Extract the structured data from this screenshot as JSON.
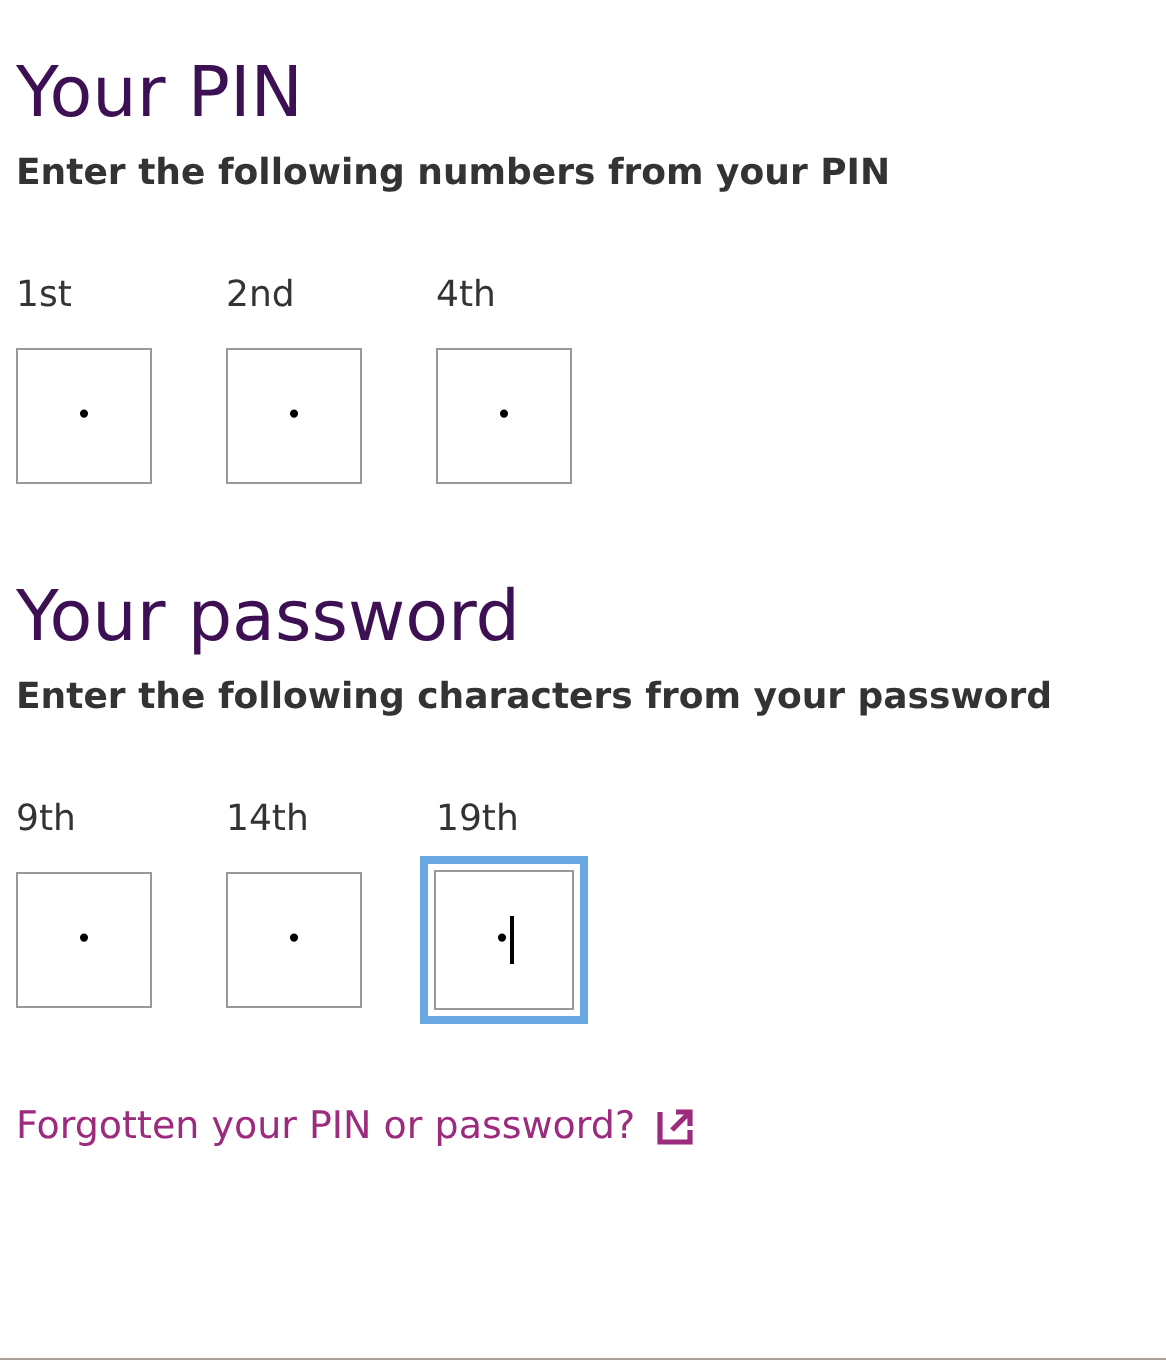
{
  "sections": [
    {
      "title": "Your PIN",
      "instruction": "Enter the following numbers from your PIN",
      "fields": [
        {
          "label": "1st",
          "value": "•",
          "focused": false
        },
        {
          "label": "2nd",
          "value": "•",
          "focused": false
        },
        {
          "label": "4th",
          "value": "•",
          "focused": false
        }
      ]
    },
    {
      "title": "Your password",
      "instruction": "Enter the following characters from your password",
      "fields": [
        {
          "label": "9th",
          "value": "•",
          "focused": false
        },
        {
          "label": "14th",
          "value": "•",
          "focused": false
        },
        {
          "label": "19th",
          "value": "•",
          "focused": true
        }
      ]
    }
  ],
  "help_link": {
    "label": "Forgotten your PIN or password?"
  }
}
